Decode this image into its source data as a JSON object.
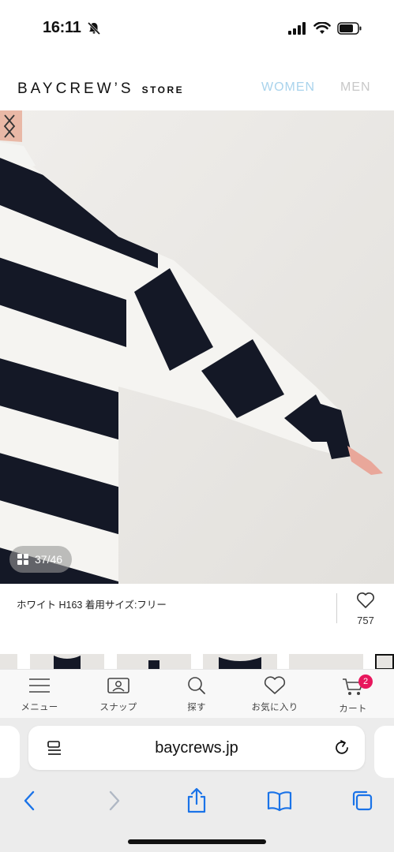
{
  "status_bar": {
    "time": "16:11"
  },
  "header": {
    "brand_main": "BAYCREW’S",
    "brand_sub": "STORE",
    "nav_women": "WOMEN",
    "nav_men": "MEN",
    "colors": {
      "women": "#a9d3ec",
      "men": "#c8c8c8"
    }
  },
  "gallery": {
    "counter": "37/46",
    "current_index": 37,
    "total": 46
  },
  "product": {
    "caption": "ホワイト H163 着用サイズ:フリー",
    "favorites_count": "757"
  },
  "app_nav": {
    "items": [
      {
        "label": "メニュー",
        "icon": "hamburger-menu-icon"
      },
      {
        "label": "スナップ",
        "icon": "snap-photo-icon"
      },
      {
        "label": "探す",
        "icon": "search-icon"
      },
      {
        "label": "お気に入り",
        "icon": "heart-icon"
      },
      {
        "label": "カート",
        "icon": "cart-icon"
      }
    ],
    "cart_badge": "2",
    "badge_color": "#e8175d"
  },
  "browser": {
    "url": "baycrews.jp",
    "accent_color": "#1a73e8"
  }
}
